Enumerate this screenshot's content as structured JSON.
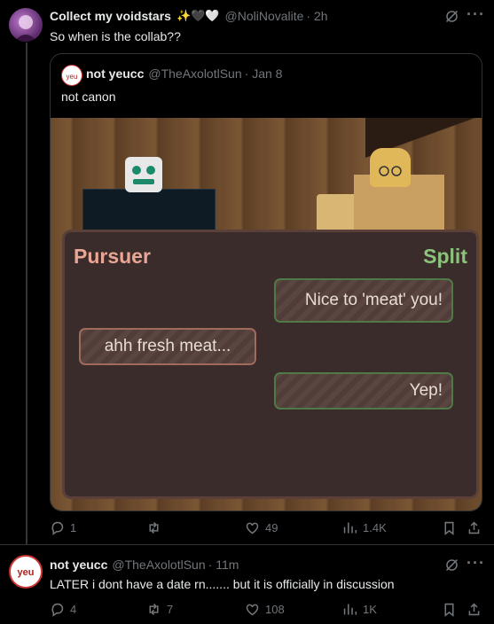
{
  "post1": {
    "display_name": "Collect my voidstars",
    "emojis": "✨🖤🤍",
    "handle": "@NoliNovalite",
    "time": "· 2h",
    "text": "So when is the collab??",
    "stats": {
      "replies": "1",
      "retweets": "",
      "likes": "49",
      "views": "1.4K"
    }
  },
  "quote": {
    "display_name": "not yeucc",
    "handle": "@TheAxolotlSun",
    "time": "· Jan 8",
    "text": "not canon",
    "game": {
      "left_title": "Pursuer",
      "right_title": "Split",
      "bubble_right_1": "Nice to 'meat' you!",
      "bubble_left": "ahh fresh meat...",
      "bubble_right_2": "Yep!"
    }
  },
  "post2": {
    "display_name": "not yeucc",
    "handle": "@TheAxolotlSun",
    "time": "· 11m",
    "text": "LATER i dont have a date rn....... but it is officially in discussion",
    "stats": {
      "replies": "4",
      "retweets": "7",
      "likes": "108",
      "views": "1K"
    }
  },
  "colors": {
    "background": "#000000",
    "muted": "#71767b",
    "pursuer": "#e9a694",
    "split": "#8cc37c",
    "divider": "#2f3336"
  }
}
